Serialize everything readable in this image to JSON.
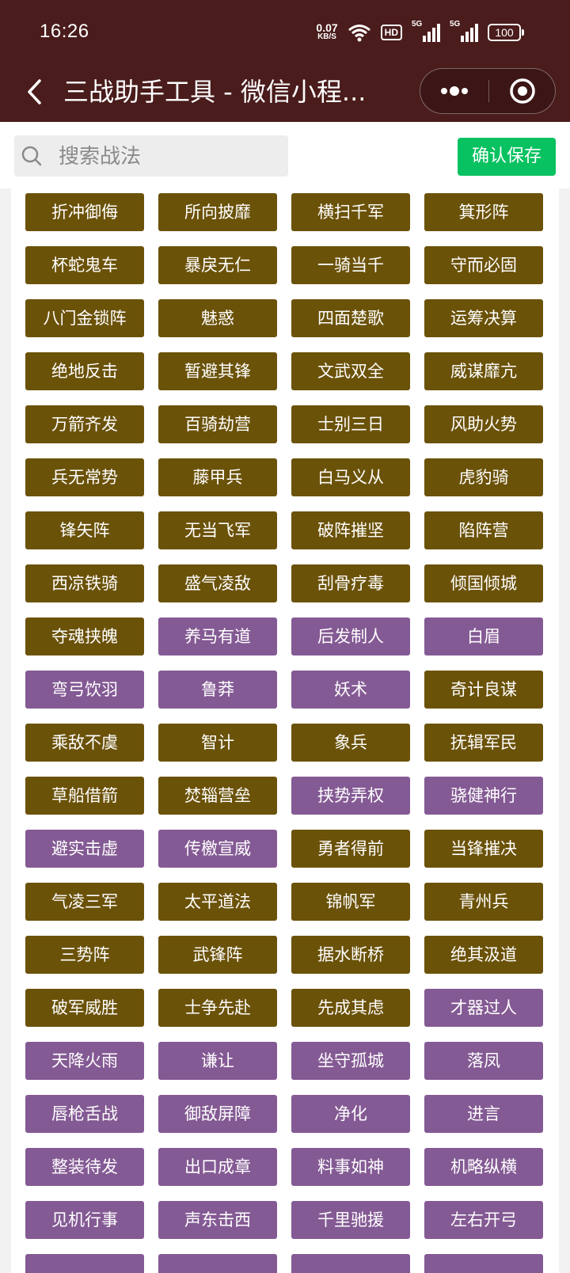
{
  "status_bar": {
    "time": "16:26",
    "net_speed_value": "0.07",
    "net_speed_unit": "KB/S",
    "hd_badge": "HD",
    "signal_label_1": "5G",
    "signal_label_2": "5G",
    "battery": "100"
  },
  "nav": {
    "title": "三战助手工具 - 微信小程..."
  },
  "search": {
    "placeholder": "搜索战法",
    "value": ""
  },
  "save_button": "确认保存",
  "colors": {
    "gold": "#6b5209",
    "purple": "#845a94",
    "header": "#4a1c1c",
    "save": "#08c160"
  },
  "skills": [
    {
      "name": "折冲御侮",
      "tier": "gold"
    },
    {
      "name": "所向披靡",
      "tier": "gold"
    },
    {
      "name": "横扫千军",
      "tier": "gold"
    },
    {
      "name": "箕形阵",
      "tier": "gold"
    },
    {
      "name": "杯蛇鬼车",
      "tier": "gold"
    },
    {
      "name": "暴戾无仁",
      "tier": "gold"
    },
    {
      "name": "一骑当千",
      "tier": "gold"
    },
    {
      "name": "守而必固",
      "tier": "gold"
    },
    {
      "name": "八门金锁阵",
      "tier": "gold"
    },
    {
      "name": "魅惑",
      "tier": "gold"
    },
    {
      "name": "四面楚歌",
      "tier": "gold"
    },
    {
      "name": "运筹决算",
      "tier": "gold"
    },
    {
      "name": "绝地反击",
      "tier": "gold"
    },
    {
      "name": "暂避其锋",
      "tier": "gold"
    },
    {
      "name": "文武双全",
      "tier": "gold"
    },
    {
      "name": "威谋靡亢",
      "tier": "gold"
    },
    {
      "name": "万箭齐发",
      "tier": "gold"
    },
    {
      "name": "百骑劫营",
      "tier": "gold"
    },
    {
      "name": "士别三日",
      "tier": "gold"
    },
    {
      "name": "风助火势",
      "tier": "gold"
    },
    {
      "name": "兵无常势",
      "tier": "gold"
    },
    {
      "name": "藤甲兵",
      "tier": "gold"
    },
    {
      "name": "白马义从",
      "tier": "gold"
    },
    {
      "name": "虎豹骑",
      "tier": "gold"
    },
    {
      "name": "锋矢阵",
      "tier": "gold"
    },
    {
      "name": "无当飞军",
      "tier": "gold"
    },
    {
      "name": "破阵摧坚",
      "tier": "gold"
    },
    {
      "name": "陷阵营",
      "tier": "gold"
    },
    {
      "name": "西凉铁骑",
      "tier": "gold"
    },
    {
      "name": "盛气凌敌",
      "tier": "gold"
    },
    {
      "name": "刮骨疗毒",
      "tier": "gold"
    },
    {
      "name": "倾国倾城",
      "tier": "gold"
    },
    {
      "name": "夺魂挟魄",
      "tier": "gold"
    },
    {
      "name": "养马有道",
      "tier": "purple"
    },
    {
      "name": "后发制人",
      "tier": "purple"
    },
    {
      "name": "白眉",
      "tier": "purple"
    },
    {
      "name": "弯弓饮羽",
      "tier": "purple"
    },
    {
      "name": "鲁莽",
      "tier": "purple"
    },
    {
      "name": "妖术",
      "tier": "purple"
    },
    {
      "name": "奇计良谋",
      "tier": "gold"
    },
    {
      "name": "乘敌不虞",
      "tier": "gold"
    },
    {
      "name": "智计",
      "tier": "gold"
    },
    {
      "name": "象兵",
      "tier": "gold"
    },
    {
      "name": "抚辑军民",
      "tier": "gold"
    },
    {
      "name": "草船借箭",
      "tier": "gold"
    },
    {
      "name": "焚辎营垒",
      "tier": "gold"
    },
    {
      "name": "挟势弄权",
      "tier": "purple"
    },
    {
      "name": "骁健神行",
      "tier": "purple"
    },
    {
      "name": "避实击虚",
      "tier": "purple"
    },
    {
      "name": "传檄宣威",
      "tier": "purple"
    },
    {
      "name": "勇者得前",
      "tier": "gold"
    },
    {
      "name": "当锋摧决",
      "tier": "gold"
    },
    {
      "name": "气凌三军",
      "tier": "gold"
    },
    {
      "name": "太平道法",
      "tier": "gold"
    },
    {
      "name": "锦帆军",
      "tier": "gold"
    },
    {
      "name": "青州兵",
      "tier": "gold"
    },
    {
      "name": "三势阵",
      "tier": "gold"
    },
    {
      "name": "武锋阵",
      "tier": "gold"
    },
    {
      "name": "据水断桥",
      "tier": "gold"
    },
    {
      "name": "绝其汲道",
      "tier": "gold"
    },
    {
      "name": "破军威胜",
      "tier": "gold"
    },
    {
      "name": "士争先赴",
      "tier": "gold"
    },
    {
      "name": "先成其虑",
      "tier": "gold"
    },
    {
      "name": "才器过人",
      "tier": "purple"
    },
    {
      "name": "天降火雨",
      "tier": "purple"
    },
    {
      "name": "谦让",
      "tier": "purple"
    },
    {
      "name": "坐守孤城",
      "tier": "purple"
    },
    {
      "name": "落凤",
      "tier": "purple"
    },
    {
      "name": "唇枪舌战",
      "tier": "purple"
    },
    {
      "name": "御敌屏障",
      "tier": "purple"
    },
    {
      "name": "净化",
      "tier": "purple"
    },
    {
      "name": "进言",
      "tier": "purple"
    },
    {
      "name": "整装待发",
      "tier": "purple"
    },
    {
      "name": "出口成章",
      "tier": "purple"
    },
    {
      "name": "料事如神",
      "tier": "purple"
    },
    {
      "name": "机略纵横",
      "tier": "purple"
    },
    {
      "name": "见机行事",
      "tier": "purple"
    },
    {
      "name": "声东击西",
      "tier": "purple"
    },
    {
      "name": "千里驰援",
      "tier": "purple"
    },
    {
      "name": "左右开弓",
      "tier": "purple"
    },
    {
      "name": "",
      "tier": "purple"
    },
    {
      "name": "",
      "tier": "purple"
    },
    {
      "name": "",
      "tier": "purple"
    },
    {
      "name": "",
      "tier": "purple"
    }
  ]
}
